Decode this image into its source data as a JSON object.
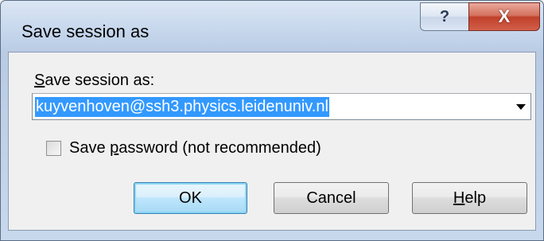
{
  "window": {
    "title": "Save session as",
    "help_glyph": "?",
    "close_glyph": "X"
  },
  "form": {
    "label_prefix_underlined": "S",
    "label_rest": "ave session as:",
    "combo_value": "kuyvenhoven@ssh3.physics.leidenuniv.nl",
    "checkbox_checked": false,
    "checkbox_label_before": "Save ",
    "checkbox_label_underlined": "p",
    "checkbox_label_after": "assword (not recommended)"
  },
  "buttons": {
    "ok": "OK",
    "cancel": "Cancel",
    "help_underlined": "H",
    "help_rest": "elp"
  },
  "icons": {
    "help": "help-icon",
    "close": "close-icon",
    "dropdown": "chevron-down-icon"
  },
  "colors": {
    "selection": "#3399ff",
    "close_button": "#c1402b",
    "default_button_border": "#3c7fb1"
  }
}
